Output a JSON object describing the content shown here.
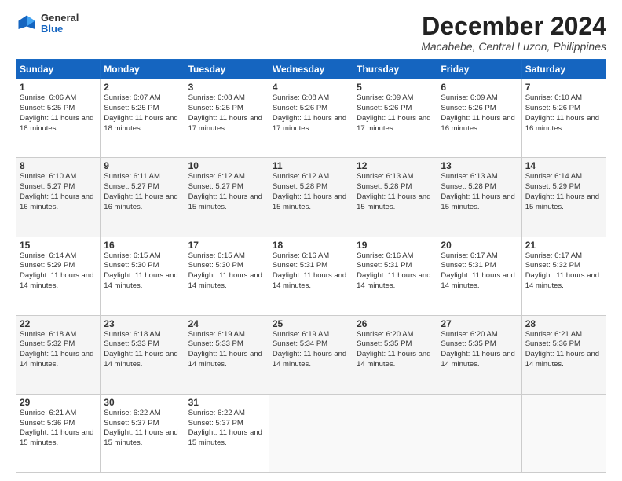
{
  "header": {
    "logo_line1": "General",
    "logo_line2": "Blue",
    "title": "December 2024",
    "subtitle": "Macabebe, Central Luzon, Philippines"
  },
  "days_of_week": [
    "Sunday",
    "Monday",
    "Tuesday",
    "Wednesday",
    "Thursday",
    "Friday",
    "Saturday"
  ],
  "weeks": [
    [
      {
        "day": "1",
        "sunrise": "6:06 AM",
        "sunset": "5:25 PM",
        "daylight": "11 hours and 18 minutes."
      },
      {
        "day": "2",
        "sunrise": "6:07 AM",
        "sunset": "5:25 PM",
        "daylight": "11 hours and 18 minutes."
      },
      {
        "day": "3",
        "sunrise": "6:08 AM",
        "sunset": "5:25 PM",
        "daylight": "11 hours and 17 minutes."
      },
      {
        "day": "4",
        "sunrise": "6:08 AM",
        "sunset": "5:26 PM",
        "daylight": "11 hours and 17 minutes."
      },
      {
        "day": "5",
        "sunrise": "6:09 AM",
        "sunset": "5:26 PM",
        "daylight": "11 hours and 17 minutes."
      },
      {
        "day": "6",
        "sunrise": "6:09 AM",
        "sunset": "5:26 PM",
        "daylight": "11 hours and 16 minutes."
      },
      {
        "day": "7",
        "sunrise": "6:10 AM",
        "sunset": "5:26 PM",
        "daylight": "11 hours and 16 minutes."
      }
    ],
    [
      {
        "day": "8",
        "sunrise": "6:10 AM",
        "sunset": "5:27 PM",
        "daylight": "11 hours and 16 minutes."
      },
      {
        "day": "9",
        "sunrise": "6:11 AM",
        "sunset": "5:27 PM",
        "daylight": "11 hours and 16 minutes."
      },
      {
        "day": "10",
        "sunrise": "6:12 AM",
        "sunset": "5:27 PM",
        "daylight": "11 hours and 15 minutes."
      },
      {
        "day": "11",
        "sunrise": "6:12 AM",
        "sunset": "5:28 PM",
        "daylight": "11 hours and 15 minutes."
      },
      {
        "day": "12",
        "sunrise": "6:13 AM",
        "sunset": "5:28 PM",
        "daylight": "11 hours and 15 minutes."
      },
      {
        "day": "13",
        "sunrise": "6:13 AM",
        "sunset": "5:28 PM",
        "daylight": "11 hours and 15 minutes."
      },
      {
        "day": "14",
        "sunrise": "6:14 AM",
        "sunset": "5:29 PM",
        "daylight": "11 hours and 15 minutes."
      }
    ],
    [
      {
        "day": "15",
        "sunrise": "6:14 AM",
        "sunset": "5:29 PM",
        "daylight": "11 hours and 14 minutes."
      },
      {
        "day": "16",
        "sunrise": "6:15 AM",
        "sunset": "5:30 PM",
        "daylight": "11 hours and 14 minutes."
      },
      {
        "day": "17",
        "sunrise": "6:15 AM",
        "sunset": "5:30 PM",
        "daylight": "11 hours and 14 minutes."
      },
      {
        "day": "18",
        "sunrise": "6:16 AM",
        "sunset": "5:31 PM",
        "daylight": "11 hours and 14 minutes."
      },
      {
        "day": "19",
        "sunrise": "6:16 AM",
        "sunset": "5:31 PM",
        "daylight": "11 hours and 14 minutes."
      },
      {
        "day": "20",
        "sunrise": "6:17 AM",
        "sunset": "5:31 PM",
        "daylight": "11 hours and 14 minutes."
      },
      {
        "day": "21",
        "sunrise": "6:17 AM",
        "sunset": "5:32 PM",
        "daylight": "11 hours and 14 minutes."
      }
    ],
    [
      {
        "day": "22",
        "sunrise": "6:18 AM",
        "sunset": "5:32 PM",
        "daylight": "11 hours and 14 minutes."
      },
      {
        "day": "23",
        "sunrise": "6:18 AM",
        "sunset": "5:33 PM",
        "daylight": "11 hours and 14 minutes."
      },
      {
        "day": "24",
        "sunrise": "6:19 AM",
        "sunset": "5:33 PM",
        "daylight": "11 hours and 14 minutes."
      },
      {
        "day": "25",
        "sunrise": "6:19 AM",
        "sunset": "5:34 PM",
        "daylight": "11 hours and 14 minutes."
      },
      {
        "day": "26",
        "sunrise": "6:20 AM",
        "sunset": "5:35 PM",
        "daylight": "11 hours and 14 minutes."
      },
      {
        "day": "27",
        "sunrise": "6:20 AM",
        "sunset": "5:35 PM",
        "daylight": "11 hours and 14 minutes."
      },
      {
        "day": "28",
        "sunrise": "6:21 AM",
        "sunset": "5:36 PM",
        "daylight": "11 hours and 14 minutes."
      }
    ],
    [
      {
        "day": "29",
        "sunrise": "6:21 AM",
        "sunset": "5:36 PM",
        "daylight": "11 hours and 15 minutes."
      },
      {
        "day": "30",
        "sunrise": "6:22 AM",
        "sunset": "5:37 PM",
        "daylight": "11 hours and 15 minutes."
      },
      {
        "day": "31",
        "sunrise": "6:22 AM",
        "sunset": "5:37 PM",
        "daylight": "11 hours and 15 minutes."
      },
      null,
      null,
      null,
      null
    ]
  ]
}
